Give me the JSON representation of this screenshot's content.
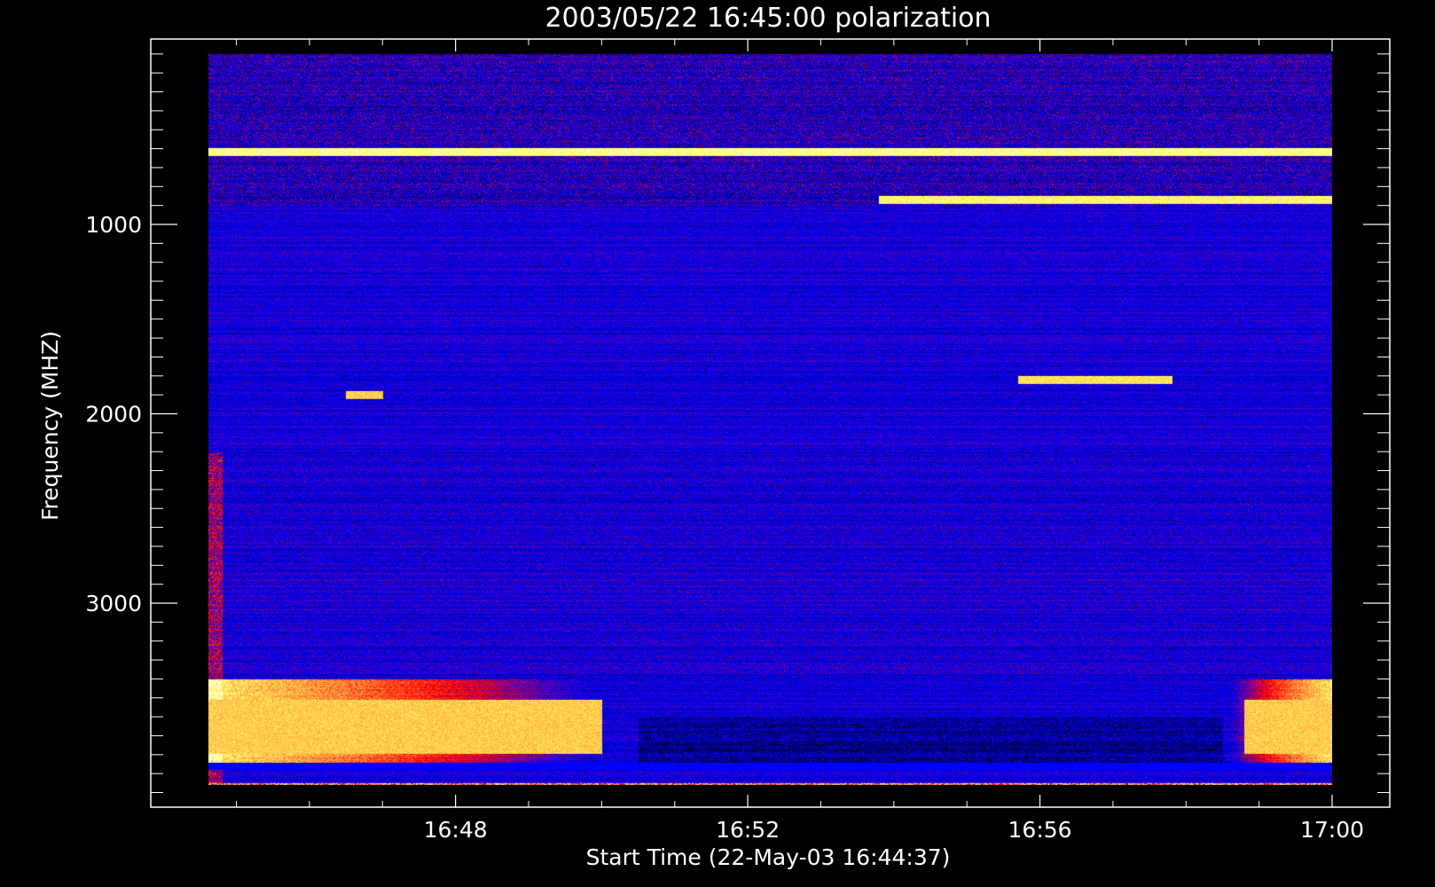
{
  "chart_data": {
    "type": "heatmap",
    "title": "2003/05/22 16:45:00 polarization",
    "xlabel": "Start Time (22-May-03 16:44:37)",
    "ylabel": "Frequency (MHZ)",
    "x_tick_labels": [
      "16:48",
      "16:52",
      "16:56",
      "17:00"
    ],
    "x_tick_minutes": [
      48,
      52,
      56,
      60
    ],
    "y_tick_labels": [
      "1000",
      "2000",
      "3000"
    ],
    "y_tick_values": [
      1000,
      2000,
      3000
    ],
    "xlim_minutes": [
      44.0,
      60.0
    ],
    "ylim": [
      4200,
      0
    ],
    "data_extent": {
      "time_start_minutes": 44.617,
      "time_end_minutes": 60.0,
      "freq_start": 100,
      "freq_end": 3960
    },
    "colormap": [
      "#000000",
      "#0000ff",
      "#ff0000",
      "#ff9a40",
      "#ffff60",
      "#ffffff"
    ],
    "features": [
      {
        "name": "yellow line",
        "freq": 615,
        "t0": 44.617,
        "t1": 60.0,
        "level": 0.85
      },
      {
        "name": "yellow line late",
        "freq": 870,
        "t0": 53.8,
        "t1": 60.0,
        "level": 0.8
      },
      {
        "name": "red-orange burst",
        "freq": 1820,
        "t0": 55.7,
        "t1": 57.8,
        "level": 0.75
      },
      {
        "name": "red band",
        "freq": 1900,
        "t0": 46.5,
        "t1": 47.0,
        "level": 0.7
      },
      {
        "name": "bright bottom band early",
        "freq": 3650,
        "t0": 44.617,
        "t1": 50.0,
        "level": 0.7
      },
      {
        "name": "bright bottom band late",
        "freq": 3650,
        "t0": 58.8,
        "t1": 60.0,
        "level": 0.7
      }
    ]
  },
  "colors": {
    "background": "#000000",
    "axes": "#ffffff",
    "text": "#ffffff"
  }
}
